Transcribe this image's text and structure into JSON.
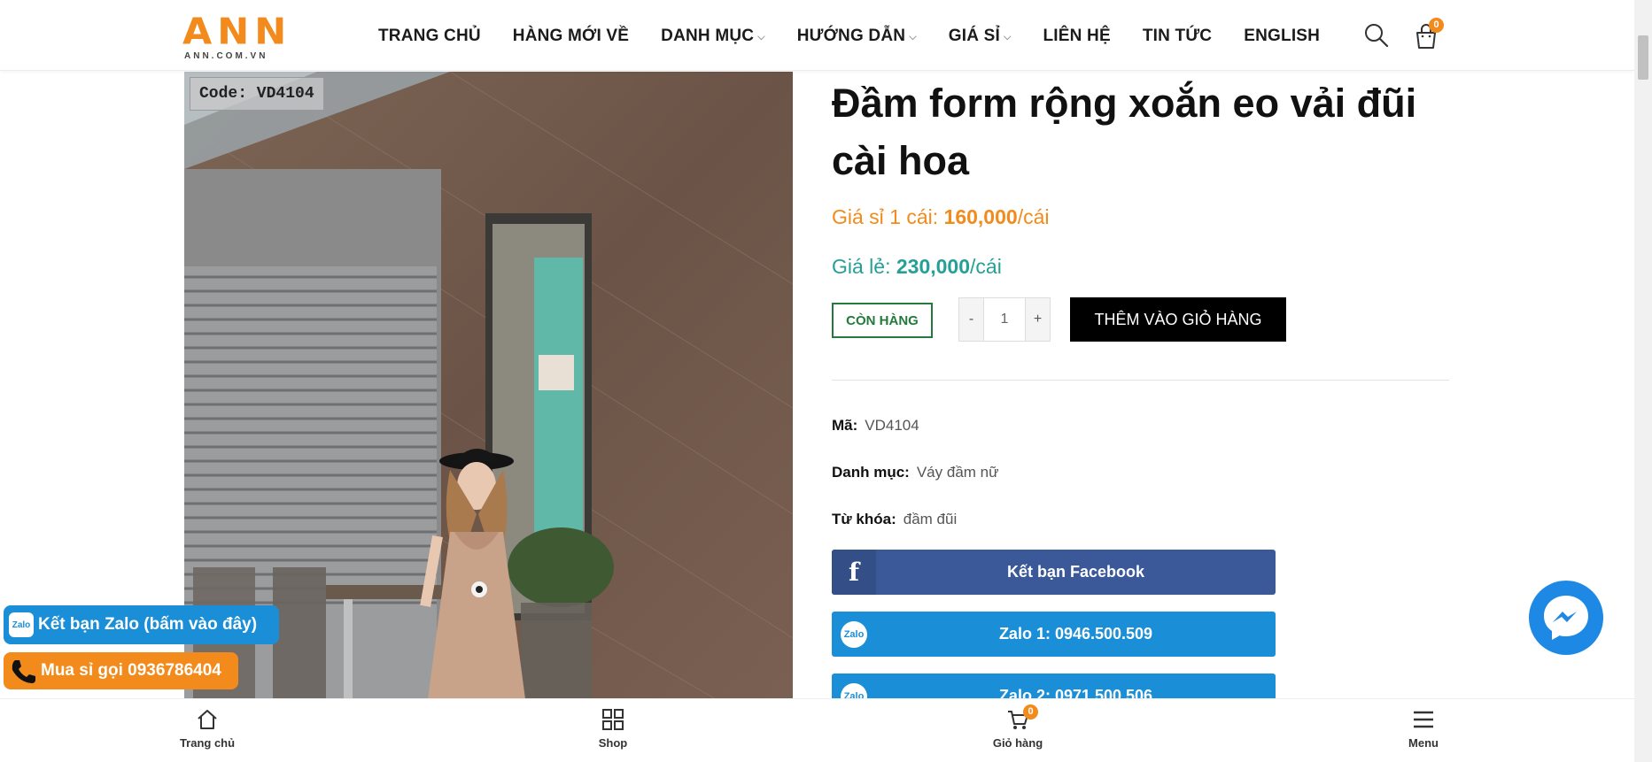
{
  "header": {
    "logo_main": "ANN",
    "logo_sub": "ANN.COM.VN",
    "nav": [
      {
        "label": "TRANG CHỦ",
        "dropdown": false
      },
      {
        "label": "HÀNG MỚI VỀ",
        "dropdown": false
      },
      {
        "label": "DANH MỤC",
        "dropdown": true
      },
      {
        "label": "HƯỚNG DẪN",
        "dropdown": true
      },
      {
        "label": "GIÁ SỈ",
        "dropdown": true
      },
      {
        "label": "LIÊN HỆ",
        "dropdown": false
      },
      {
        "label": "TIN TỨC",
        "dropdown": false
      },
      {
        "label": "ENGLISH",
        "dropdown": false
      }
    ],
    "cart_count": "0",
    "search_icon": "search-icon",
    "cart_icon": "shopping-bag-icon"
  },
  "product": {
    "code_tag": "Code: VD4104",
    "title": "Đầm form rộng xoắn eo vải đũi cài hoa",
    "wholesale_label": "Giá sỉ 1 cái: ",
    "wholesale_price": "160,000",
    "wholesale_unit": "/cái",
    "retail_label": "Giá lẻ: ",
    "retail_price": "230,000",
    "retail_unit": "/cái",
    "stock_status": "CÒN HÀNG",
    "qty_minus": "-",
    "qty_value": "1",
    "qty_plus": "+",
    "add_to_cart": "THÊM VÀO GIỎ HÀNG",
    "sku_label": "Mã:",
    "sku_value": "VD4104",
    "category_label": "Danh mục:",
    "category_value": "Váy đầm nữ",
    "tags_label": "Từ khóa:",
    "tags_value": "đầm đũi"
  },
  "social": {
    "facebook": "Kết bạn Facebook",
    "zalo1": "Zalo 1: 0946.500.509",
    "zalo2": "Zalo 2: 0971.500.506",
    "zalo_icon_text": "Zalo"
  },
  "floating": {
    "zalo": "Kết bạn Zalo (bấm vào đây)",
    "call": "Mua sỉ gọi 0936786404"
  },
  "bottom_nav": [
    {
      "label": "Trang chủ",
      "icon": "home-icon"
    },
    {
      "label": "Shop",
      "icon": "grid-icon"
    },
    {
      "label": "Giỏ hàng",
      "icon": "cart-icon"
    },
    {
      "label": "Menu",
      "icon": "menu-icon"
    }
  ],
  "bottom_cart_count": "0",
  "colors": {
    "brand_orange": "#f28a1c",
    "retail_teal": "#25a097",
    "stock_green": "#237a3a",
    "facebook_blue": "#3b5998",
    "zalo_blue": "#1a8fd8",
    "messenger_blue": "#1e88e5"
  }
}
